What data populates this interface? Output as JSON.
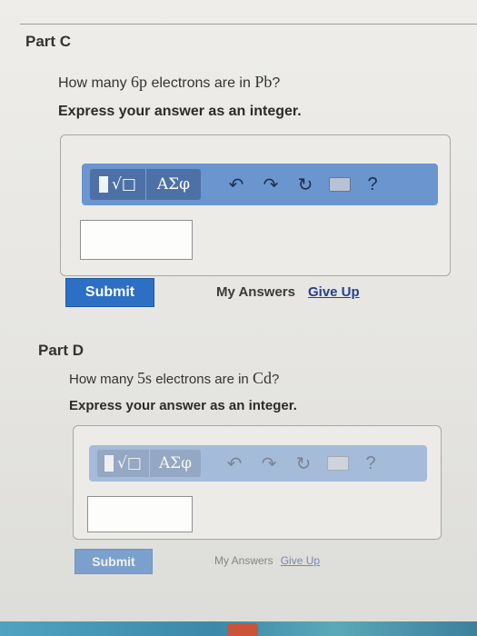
{
  "parts": [
    {
      "title": "Part C",
      "question_pre": "How many ",
      "orbital": "6p",
      "question_mid": " electrons are in ",
      "element": "Pb",
      "question_post": "?",
      "instruction": "Express your answer as an integer.",
      "answer_value": "",
      "submit_label": "Submit",
      "my_answers_label": "My Answers",
      "give_up_label": "Give Up"
    },
    {
      "title": "Part D",
      "question_pre": "How many ",
      "orbital": "5s",
      "question_mid": " electrons are in ",
      "element": "Cd",
      "question_post": "?",
      "instruction": "Express your answer as an integer.",
      "answer_value": "",
      "submit_label": "Submit",
      "my_answers_label": "My Answers",
      "give_up_label": "Give Up"
    }
  ],
  "toolbar": {
    "template_icon": "template-radical-icon",
    "greek_label": "ΑΣφ",
    "undo_icon": "undo-icon",
    "redo_icon": "redo-icon",
    "reset_icon": "reset-icon",
    "keyboard_icon": "keyboard-icon",
    "help_label": "?"
  },
  "colors": {
    "toolbar": "#6b95cf",
    "submit": "#2d6fc4",
    "link": "#26408f"
  }
}
